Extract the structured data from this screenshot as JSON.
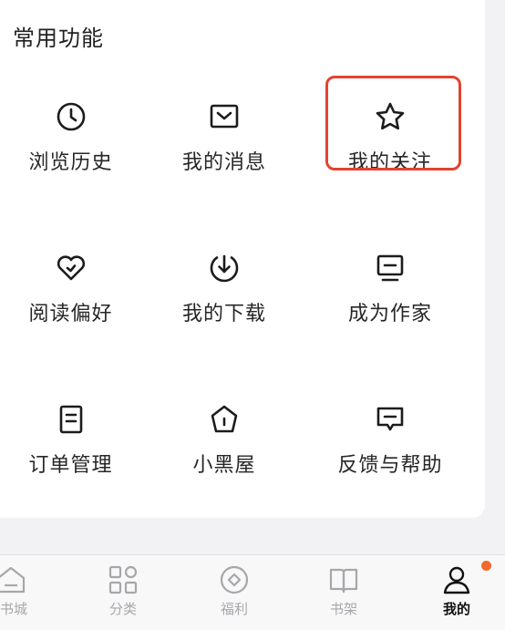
{
  "section": {
    "title": "常用功能"
  },
  "features": [
    {
      "label": "浏览历史",
      "icon": "clock-icon",
      "name": "feature-history"
    },
    {
      "label": "我的消息",
      "icon": "mail-icon",
      "name": "feature-messages"
    },
    {
      "label": "我的关注",
      "icon": "star-icon",
      "name": "feature-following"
    },
    {
      "label": "阅读偏好",
      "icon": "heart-check-icon",
      "name": "feature-reading-preference"
    },
    {
      "label": "我的下载",
      "icon": "download-icon",
      "name": "feature-downloads"
    },
    {
      "label": "成为作家",
      "icon": "monitor-icon",
      "name": "feature-become-writer"
    },
    {
      "label": "订单管理",
      "icon": "document-icon",
      "name": "feature-orders"
    },
    {
      "label": "小黑屋",
      "icon": "house-icon",
      "name": "feature-blacklist"
    },
    {
      "label": "反馈与帮助",
      "icon": "chat-icon",
      "name": "feature-feedback"
    }
  ],
  "highlight": {
    "target": "我的关注",
    "color": "#e3432f"
  },
  "tabbar": {
    "tabs": [
      {
        "label": "书城",
        "icon": "home-icon",
        "active": false
      },
      {
        "label": "分类",
        "icon": "grid-icon",
        "active": false
      },
      {
        "label": "福利",
        "icon": "coin-icon",
        "active": false
      },
      {
        "label": "书架",
        "icon": "book-icon",
        "active": false
      },
      {
        "label": "我的",
        "icon": "user-icon",
        "active": true,
        "dot_color": "#f26a2e"
      }
    ]
  },
  "colors": {
    "accent": "#f26a2e",
    "background": "#f2f2f4",
    "card": "#ffffff"
  }
}
